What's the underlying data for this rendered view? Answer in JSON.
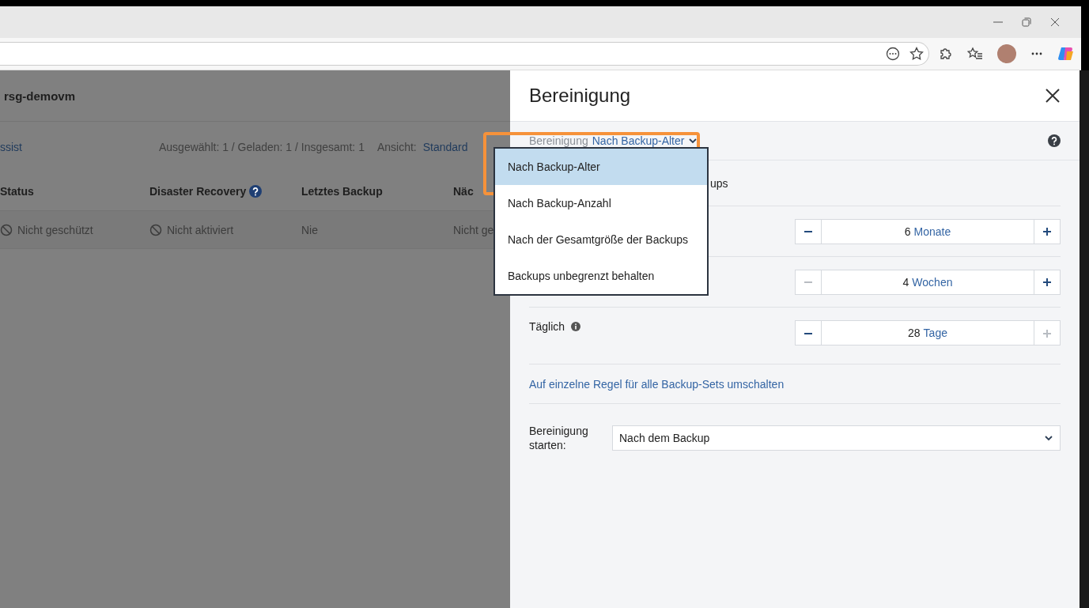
{
  "page": {
    "title": "rsg-demovm",
    "toolbar": {
      "link": "ssist",
      "counts": "Ausgewählt: 1 / Geladen: 1 / Insgesamt: 1",
      "view_label": "Ansicht:",
      "view_value": "Standard"
    },
    "columns": [
      {
        "label": "Status",
        "help": false
      },
      {
        "label": "Disaster Recovery",
        "help": true
      },
      {
        "label": "Letztes Backup",
        "help": false
      },
      {
        "label": "Näc",
        "help": false
      }
    ],
    "rows": [
      [
        {
          "text": "Nicht geschützt",
          "kind": "ban"
        },
        {
          "text": "Nicht aktiviert",
          "kind": "ban"
        },
        {
          "text": "Nie",
          "kind": "plain"
        },
        {
          "text": "Nicht ge",
          "kind": "plain"
        }
      ]
    ]
  },
  "panel": {
    "title": "Bereinigung",
    "method_label": "Bereinigung",
    "method_value": "Nach Backup-Alter",
    "menu": [
      {
        "label": "Nach Backup-Alter",
        "selected": true
      },
      {
        "label": "Nach Backup-Anzahl",
        "selected": false
      },
      {
        "label": "Nach der Gesamtgröße der Backups",
        "selected": false
      },
      {
        "label": "Backups unbegrenzt behalten",
        "selected": false
      }
    ],
    "section_text": "ups",
    "rules": [
      {
        "value": "6",
        "unit": "Monate",
        "minus_disabled": false,
        "plus_disabled": false
      },
      {
        "value": "4",
        "unit": "Wochen",
        "minus_disabled": true,
        "plus_disabled": false
      },
      {
        "label": "Täglich",
        "info": true,
        "value": "28",
        "unit": "Tage",
        "minus_disabled": false,
        "plus_disabled": true
      }
    ],
    "switch_link": "Auf einzelne Regel für alle Backup-Sets umschalten",
    "start_label": "Bereinigung starten:",
    "start_value": "Nach dem Backup"
  }
}
